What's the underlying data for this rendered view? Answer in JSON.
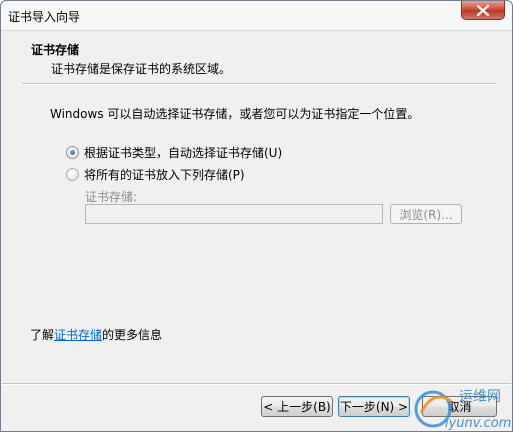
{
  "window": {
    "title": "证书导入向导"
  },
  "header": {
    "title": "证书存储",
    "subtitle": "证书存储是保存证书的系统区域。"
  },
  "content": {
    "intro": "Windows 可以自动选择证书存储，或者您可以为证书指定一个位置。",
    "option_auto": "根据证书类型，自动选择证书存储(U)",
    "option_manual": "将所有的证书放入下列存储(P)",
    "store_label": "证书存储:",
    "store_value": "",
    "browse_label": "浏览(R)...",
    "selected_option": "auto"
  },
  "more_info": {
    "prefix": "了解",
    "link": "证书存储",
    "suffix": "的更多信息"
  },
  "footer": {
    "back_label": "< 上一步(B)",
    "next_label": "下一步(N) >",
    "cancel_label": "取消"
  },
  "watermark": {
    "text_cn": "运维网",
    "text_en": "iyunv.com"
  },
  "colors": {
    "link": "#0066cc",
    "close_button": "#c7493a",
    "disabled_text": "#8d8d8d"
  }
}
